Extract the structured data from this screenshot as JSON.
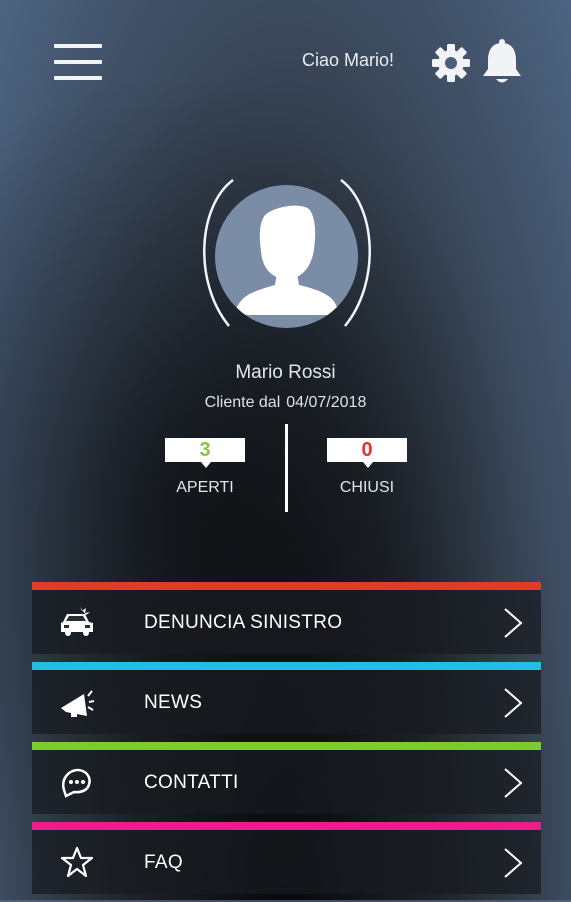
{
  "header": {
    "greeting": "Ciao Mario!",
    "menu_icon": "hamburger-menu-icon",
    "settings_icon": "gear-icon",
    "notifications_icon": "bell-icon"
  },
  "profile": {
    "avatar_icon": "user-silhouette-icon",
    "name": "Mario Rossi",
    "client_since_label": "Cliente dal",
    "client_since_date": "04/07/2018"
  },
  "stats": {
    "open_count": "3",
    "open_label": "APERTI",
    "closed_count": "0",
    "closed_label": "CHIUSI",
    "open_color": "#86c540",
    "closed_color": "#e2322b"
  },
  "menu": {
    "items": [
      {
        "label": "DENUNCIA SINISTRO",
        "icon": "car-crash-icon",
        "color": "#e13a2c"
      },
      {
        "label": "NEWS",
        "icon": "megaphone-icon",
        "color": "#1fc0e0"
      },
      {
        "label": "CONTATTI",
        "icon": "chat-bubbles-icon",
        "color": "#7dcd2a"
      },
      {
        "label": "FAQ",
        "icon": "star-icon",
        "color": "#ec1c8c"
      }
    ]
  }
}
